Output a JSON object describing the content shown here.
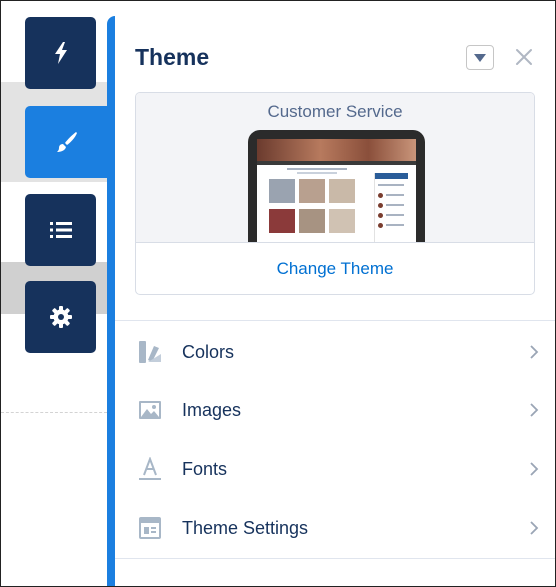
{
  "rail": {
    "buttons": [
      {
        "icon": "lightning-bolt-icon",
        "active": false
      },
      {
        "icon": "paintbrush-icon",
        "active": true
      },
      {
        "icon": "list-icon",
        "active": false
      },
      {
        "icon": "gear-icon",
        "active": false
      }
    ]
  },
  "panel": {
    "title": "Theme",
    "dropdown_icon": "caret-down-icon",
    "close_icon": "close-icon",
    "theme_card": {
      "theme_name": "Customer Service",
      "change_label": "Change Theme"
    },
    "menu": [
      {
        "label": "Colors",
        "icon": "colors-palette-icon"
      },
      {
        "label": "Images",
        "icon": "image-icon"
      },
      {
        "label": "Fonts",
        "icon": "font-icon"
      },
      {
        "label": "Theme Settings",
        "icon": "layout-settings-icon"
      }
    ]
  },
  "colors": {
    "navy": "#16325c",
    "accent_blue": "#1b7fe0",
    "link_blue": "#0070d2",
    "muted": "#54698d",
    "icon_gray": "#a8b7c7"
  }
}
